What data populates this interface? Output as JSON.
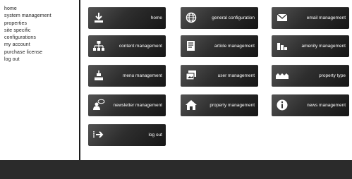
{
  "sidebar": {
    "items": [
      {
        "label": "home"
      },
      {
        "label": "system management"
      },
      {
        "label": "properties"
      },
      {
        "label": "site specific"
      },
      {
        "label": "configurations"
      },
      {
        "label": "my account"
      },
      {
        "label": "purchase license"
      },
      {
        "label": "log out"
      }
    ]
  },
  "tiles": [
    {
      "label": "home",
      "icon": "home-download-icon"
    },
    {
      "label": "general configuration",
      "icon": "globe-icon"
    },
    {
      "label": "email management",
      "icon": "envelope-icon"
    },
    {
      "label": "content management",
      "icon": "sitemap-icon"
    },
    {
      "label": "article management",
      "icon": "document-icon"
    },
    {
      "label": "amenity management",
      "icon": "bar-chart-icon"
    },
    {
      "label": "menu management",
      "icon": "menu-cursor-icon"
    },
    {
      "label": "user management",
      "icon": "photos-icon"
    },
    {
      "label": "property type",
      "icon": "houses-icon"
    },
    {
      "label": "newsletter management",
      "icon": "person-speech-icon"
    },
    {
      "label": "property management",
      "icon": "house-icon"
    },
    {
      "label": "news management",
      "icon": "info-icon"
    },
    {
      "label": "log out",
      "icon": "logout-arrow-icon"
    }
  ],
  "colors": {
    "tile_background": "#2e2e2e",
    "footer_background": "#2b2b2b",
    "divider": "#1c1c1c"
  }
}
